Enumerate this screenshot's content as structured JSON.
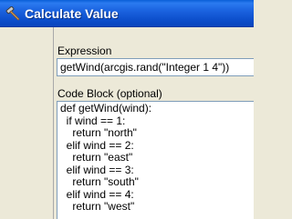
{
  "window": {
    "title": "Calculate Value",
    "title_icon": "hammer-icon"
  },
  "expression": {
    "label": "Expression",
    "value": "getWind(arcgis.rand(\"Integer 1 4\"))"
  },
  "code_block": {
    "label": "Code Block (optional)",
    "lines": [
      "def getWind(wind):",
      "  if wind == 1:",
      "    return \"north\"",
      "  elif wind == 2:",
      "    return \"east\"",
      "  elif wind == 3:",
      "    return \"south\"",
      "  elif wind == 4:",
      "    return \"west\""
    ]
  },
  "colors": {
    "titlebar": "#0b4cc9",
    "window_bg": "#ece9d8",
    "input_border": "#7f9db9"
  }
}
